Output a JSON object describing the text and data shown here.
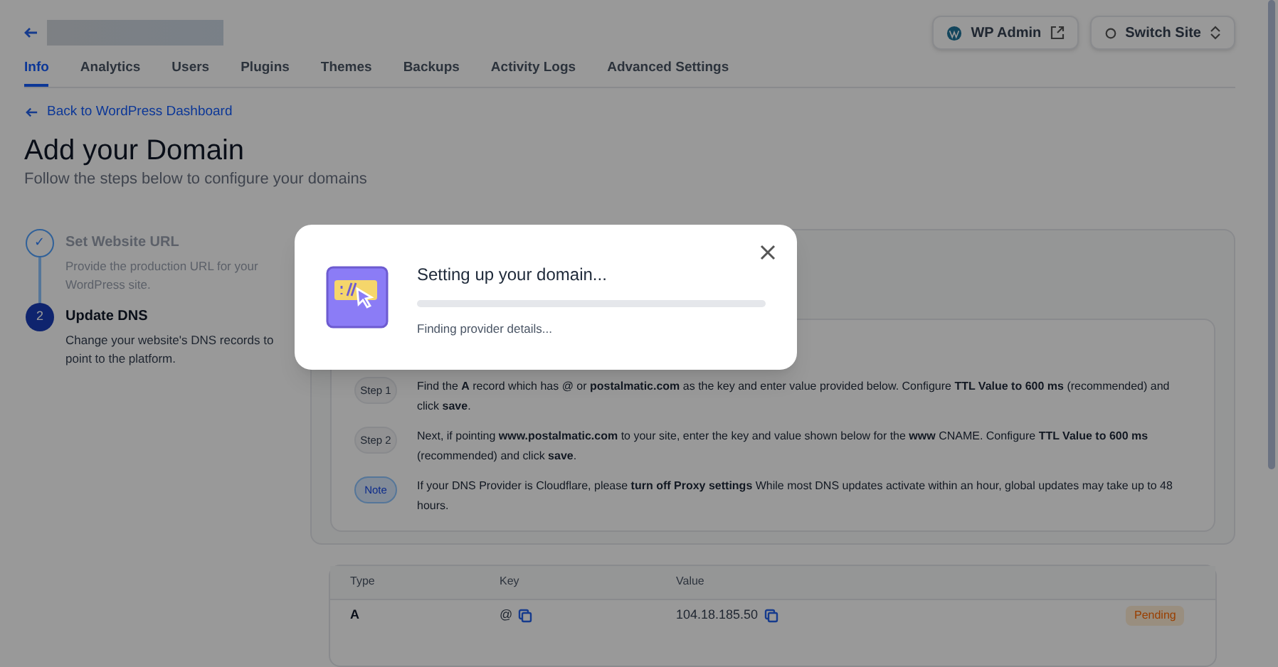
{
  "header": {
    "actions": [
      {
        "kind": "wp",
        "label": "WP Admin"
      },
      {
        "kind": "switch",
        "label": "Switch Site"
      }
    ]
  },
  "tabs": [
    {
      "label": "Info",
      "selected": true
    },
    {
      "label": "Analytics",
      "selected": false
    },
    {
      "label": "Users",
      "selected": false
    },
    {
      "label": "Plugins",
      "selected": false
    },
    {
      "label": "Themes",
      "selected": false
    },
    {
      "label": "Backups",
      "selected": false
    },
    {
      "label": "Activity Logs",
      "selected": false
    },
    {
      "label": "Advanced Settings",
      "selected": false
    }
  ],
  "back_link": "Back to WordPress Dashboard",
  "title": "Add your Domain",
  "subtitle": "Follow the steps below to configure your domains",
  "stepper": [
    {
      "marker": "✓",
      "title": "Set Website URL",
      "description": "Provide the production URL for your WordPress site.",
      "done": true
    },
    {
      "marker": "2",
      "title": "Update DNS",
      "description": "Change your website's DNS records to point to the platform.",
      "done": false
    }
  ],
  "instructions": [
    {
      "kind": "step",
      "tag": "Step 1",
      "text": "Find the **A** record which has @ or **postalmatic.com** as the key and enter value provided below. Configure **TTL Value to 600 ms** (recommended) and click **save**."
    },
    {
      "kind": "step",
      "tag": "Step 2",
      "text": "Next, if pointing **www.postalmatic.com** to your site, enter the key and value shown below for the **www** CNAME. Configure **TTL Value to 600 ms** (recommended) and click **save**."
    },
    {
      "kind": "note",
      "tag": "Note",
      "text": "If your DNS Provider is Cloudflare, please **turn off Proxy settings** While most DNS updates activate within an hour, global updates may take up to 48 hours."
    }
  ],
  "table": {
    "columns": [
      "Type",
      "Key",
      "Value"
    ],
    "rows": [
      {
        "type": "A",
        "key": "@",
        "value": "104.18.185.50",
        "status": "Pending"
      }
    ]
  },
  "dialog": {
    "title": "Setting up your domain...",
    "level": 0,
    "message": "Finding provider details..."
  }
}
